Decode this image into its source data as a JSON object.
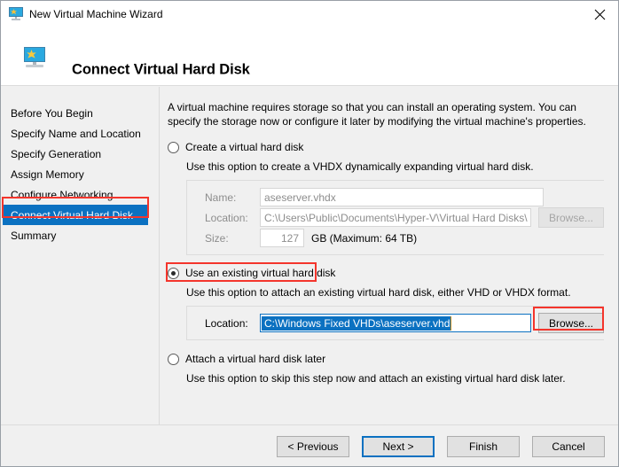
{
  "window": {
    "titlebar": {
      "title": "New Virtual Machine Wizard",
      "icon": "virtual-machine-icon",
      "close_label": "✕"
    },
    "header": {
      "title": "Connect Virtual Hard Disk",
      "icon": "virtual-machine-icon"
    }
  },
  "sidebar": {
    "items": [
      {
        "label": "Before You Begin",
        "selected": false
      },
      {
        "label": "Specify Name and Location",
        "selected": false
      },
      {
        "label": "Specify Generation",
        "selected": false
      },
      {
        "label": "Assign Memory",
        "selected": false
      },
      {
        "label": "Configure Networking",
        "selected": false
      },
      {
        "label": "Connect Virtual Hard Disk",
        "selected": true
      },
      {
        "label": "Summary",
        "selected": false
      }
    ]
  },
  "content": {
    "intro": "A virtual machine requires storage so that you can install an operating system. You can specify the storage now or configure it later by modifying the virtual machine's properties.",
    "options": [
      {
        "id": "create-new",
        "label": "Create a virtual hard disk",
        "description": "Use this option to create a VHDX dynamically expanding virtual hard disk.",
        "selected": false,
        "fields": {
          "name_label": "Name:",
          "name_value": "aseserver.vhdx",
          "location_label": "Location:",
          "location_value": "C:\\Users\\Public\\Documents\\Hyper-V\\Virtual Hard Disks\\",
          "browse_label": "Browse...",
          "size_label": "Size:",
          "size_value": "127",
          "size_units": "GB (Maximum: 64 TB)"
        }
      },
      {
        "id": "use-existing",
        "label": "Use an existing virtual hard disk",
        "description": "Use this option to attach an existing virtual hard disk, either VHD or VHDX format.",
        "selected": true,
        "fields": {
          "location_label": "Location:",
          "location_value": "C:\\Windows Fixed VHDs\\aseserver.vhd",
          "browse_label": "Browse..."
        }
      },
      {
        "id": "attach-later",
        "label": "Attach a virtual hard disk later",
        "description": "Use this option to skip this step now and attach an existing virtual hard disk later.",
        "selected": false
      }
    ]
  },
  "footer": {
    "buttons": [
      {
        "label": "< Previous",
        "default": false
      },
      {
        "label": "Next >",
        "default": true
      },
      {
        "label": "Finish",
        "default": false
      },
      {
        "label": "Cancel",
        "default": false
      }
    ]
  },
  "annotations": {
    "accent_color": "#f4352c",
    "highlight_color": "#0b71c1",
    "regions": [
      "sidebar-connect-virtual-hard-disk",
      "use-existing-radio-label",
      "existing-location-browse-button"
    ]
  }
}
